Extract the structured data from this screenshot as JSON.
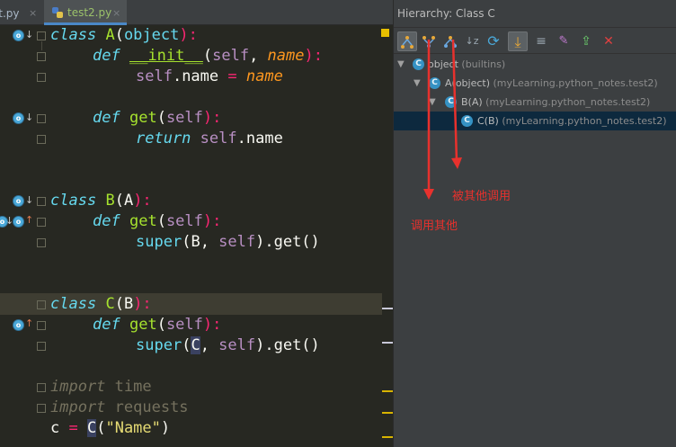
{
  "editor": {
    "tabs": [
      {
        "label": "st.py",
        "close": "×"
      },
      {
        "label": "test2.py",
        "close": "×"
      }
    ],
    "gutter_icon_letter": "o",
    "code": {
      "l1": {
        "kw": "class",
        "name": "A",
        "open": "(",
        "base": "object",
        "close": "):"
      },
      "l2": {
        "kw": "def",
        "name": "__init__",
        "open": "(",
        "self": "self",
        "comma": ", ",
        "param": "name",
        "close": "):"
      },
      "l3": {
        "self": "self",
        "attr": ".name",
        "eq": " = ",
        "val": "name"
      },
      "l4": {
        "kw": "def",
        "name": "get",
        "open": "(",
        "self": "self",
        "close": "):"
      },
      "l5": {
        "kw": "return",
        "self": "self",
        "attr": ".name"
      },
      "l6": {
        "kw": "class",
        "name": "B",
        "open": "(",
        "base": "A",
        "close": "):"
      },
      "l7": {
        "kw": "def",
        "name": "get",
        "open": "(",
        "self": "self",
        "close": "):"
      },
      "l8": {
        "fn": "super",
        "open": "(",
        "arg": "B",
        "comma": ", ",
        "self": "self",
        "rest": ").get()"
      },
      "l9": {
        "kw": "class",
        "name": "C",
        "open": "(",
        "base": "B",
        "close": "):"
      },
      "l10": {
        "kw": "def",
        "name": "get",
        "open": "(",
        "self": "self",
        "close": "):"
      },
      "l11": {
        "fn": "super",
        "open": "(",
        "arg": "C",
        "comma": ", ",
        "self": "self",
        "rest": ").get()"
      },
      "l12": {
        "kw": "import",
        "mod": " time"
      },
      "l13": {
        "kw": "import",
        "mod": " requests"
      },
      "l14": {
        "var": "c",
        "eq": " = ",
        "cls": "C",
        "open": "(",
        "str": "\"Name\"",
        "close": ")"
      }
    }
  },
  "hierarchy": {
    "title": "Hierarchy: Class C",
    "toolbar": [
      {
        "icon": "class-hierarchy-icon",
        "glyph": "⅄"
      },
      {
        "icon": "supertypes-icon",
        "glyph": "Y"
      },
      {
        "icon": "subtypes-icon",
        "glyph": "⅄"
      },
      {
        "icon": "sort-alpha-icon",
        "glyph": "↓z"
      },
      {
        "icon": "refresh-icon",
        "glyph": "⟳"
      },
      {
        "icon": "autoscroll-icon",
        "glyph": "⤓"
      },
      {
        "icon": "expand-icon",
        "glyph": "≡"
      },
      {
        "icon": "pin-icon",
        "glyph": "✎"
      },
      {
        "icon": "export-icon",
        "glyph": "⇪"
      },
      {
        "icon": "close-icon",
        "glyph": "✕"
      }
    ],
    "tree": [
      {
        "name": "object",
        "module": "(builtins)",
        "arrow": "▼"
      },
      {
        "name": "A(object)",
        "module": "(myLearning.python_notes.test2)",
        "arrow": "▼"
      },
      {
        "name": "B(A)",
        "module": "(myLearning.python_notes.test2)",
        "arrow": "▼"
      },
      {
        "name": "C(B)",
        "module": "(myLearning.python_notes.test2)",
        "arrow": ""
      }
    ],
    "icon_letter": "C"
  },
  "annotations": {
    "called_by_others": "被其他调用",
    "calls_others": "调用其他"
  },
  "colors": {
    "annotation": "#e8312d",
    "selection": "#0d293e"
  }
}
